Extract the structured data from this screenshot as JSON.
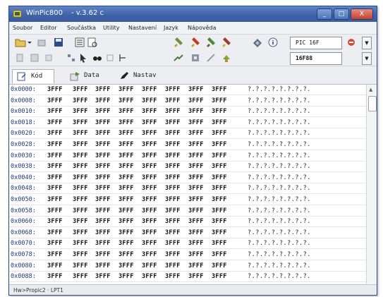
{
  "window": {
    "title": "WinPic800",
    "version": "- v.3.62 c",
    "controls": [
      "_",
      "□",
      "X"
    ]
  },
  "menu": [
    "Soubor",
    "Editor",
    "Součástka",
    "Utility",
    "Nastavení",
    "Jazyk",
    "Nápověda"
  ],
  "toolbar": {
    "row1_icons": [
      "open-folder-icon",
      "dropdown-arrow-icon",
      "recent-icon",
      "save-icon",
      "hex-view-icon",
      "preview-icon",
      "read-chip-icon",
      "write-chip-icon",
      "verify-chip-icon",
      "erase-chip-icon",
      "chip-test-icon",
      "info-icon"
    ],
    "row2_icons": [
      "copy-icon",
      "paste-icon",
      "clear-icon",
      "zoom-icon",
      "cursor-icon",
      "find-icon",
      "replace-icon",
      "fill-icon",
      "calibration-icon",
      "settings-icon",
      "hardware-icon",
      "config-icon"
    ],
    "device_family": "PIC 16F",
    "device_model": "16F88"
  },
  "tabs": [
    {
      "label": "Kód",
      "icon": "code-icon",
      "active": true
    },
    {
      "label": "Data",
      "icon": "data-icon",
      "active": false
    },
    {
      "label": "Nastav",
      "icon": "settings-pencil-icon",
      "active": false
    }
  ],
  "code_grid": {
    "rows": [
      {
        "addr": "0x0000:",
        "words": [
          "3FFF",
          "3FFF",
          "3FFF",
          "3FFF",
          "3FFF",
          "3FFF",
          "3FFF",
          "3FFF"
        ],
        "ascii": "?.?.?.?.?.?.?.?."
      },
      {
        "addr": "0x0008:",
        "words": [
          "3FFF",
          "3FFF",
          "3FFF",
          "3FFF",
          "3FFF",
          "3FFF",
          "3FFF",
          "3FFF"
        ],
        "ascii": "?.?.?.?.?.?.?.?."
      },
      {
        "addr": "0x0010:",
        "words": [
          "3FFF",
          "3FFF",
          "3FFF",
          "3FFF",
          "3FFF",
          "3FFF",
          "3FFF",
          "3FFF"
        ],
        "ascii": "?.?.?.?.?.?.?.?."
      },
      {
        "addr": "0x0018:",
        "words": [
          "3FFF",
          "3FFF",
          "3FFF",
          "3FFF",
          "3FFF",
          "3FFF",
          "3FFF",
          "3FFF"
        ],
        "ascii": "?.?.?.?.?.?.?.?."
      },
      {
        "addr": "0x0020:",
        "words": [
          "3FFF",
          "3FFF",
          "3FFF",
          "3FFF",
          "3FFF",
          "3FFF",
          "3FFF",
          "3FFF"
        ],
        "ascii": "?.?.?.?.?.?.?.?."
      },
      {
        "addr": "0x0028:",
        "words": [
          "3FFF",
          "3FFF",
          "3FFF",
          "3FFF",
          "3FFF",
          "3FFF",
          "3FFF",
          "3FFF"
        ],
        "ascii": "?.?.?.?.?.?.?.?."
      },
      {
        "addr": "0x0030:",
        "words": [
          "3FFF",
          "3FFF",
          "3FFF",
          "3FFF",
          "3FFF",
          "3FFF",
          "3FFF",
          "3FFF"
        ],
        "ascii": "?.?.?.?.?.?.?.?."
      },
      {
        "addr": "0x0038:",
        "words": [
          "3FFF",
          "3FFF",
          "3FFF",
          "3FFF",
          "3FFF",
          "3FFF",
          "3FFF",
          "3FFF"
        ],
        "ascii": "?.?.?.?.?.?.?.?."
      },
      {
        "addr": "0x0040:",
        "words": [
          "3FFF",
          "3FFF",
          "3FFF",
          "3FFF",
          "3FFF",
          "3FFF",
          "3FFF",
          "3FFF"
        ],
        "ascii": "?.?.?.?.?.?.?.?."
      },
      {
        "addr": "0x0048:",
        "words": [
          "3FFF",
          "3FFF",
          "3FFF",
          "3FFF",
          "3FFF",
          "3FFF",
          "3FFF",
          "3FFF"
        ],
        "ascii": "?.?.?.?.?.?.?.?."
      },
      {
        "addr": "0x0050:",
        "words": [
          "3FFF",
          "3FFF",
          "3FFF",
          "3FFF",
          "3FFF",
          "3FFF",
          "3FFF",
          "3FFF"
        ],
        "ascii": "?.?.?.?.?.?.?.?."
      },
      {
        "addr": "0x0058:",
        "words": [
          "3FFF",
          "3FFF",
          "3FFF",
          "3FFF",
          "3FFF",
          "3FFF",
          "3FFF",
          "3FFF"
        ],
        "ascii": "?.?.?.?.?.?.?.?."
      },
      {
        "addr": "0x0060:",
        "words": [
          "3FFF",
          "3FFF",
          "3FFF",
          "3FFF",
          "3FFF",
          "3FFF",
          "3FFF",
          "3FFF"
        ],
        "ascii": "?.?.?.?.?.?.?.?."
      },
      {
        "addr": "0x0068:",
        "words": [
          "3FFF",
          "3FFF",
          "3FFF",
          "3FFF",
          "3FFF",
          "3FFF",
          "3FFF",
          "3FFF"
        ],
        "ascii": "?.?.?.?.?.?.?.?."
      },
      {
        "addr": "0x0070:",
        "words": [
          "3FFF",
          "3FFF",
          "3FFF",
          "3FFF",
          "3FFF",
          "3FFF",
          "3FFF",
          "3FFF"
        ],
        "ascii": "?.?.?.?.?.?.?.?."
      },
      {
        "addr": "0x0078:",
        "words": [
          "3FFF",
          "3FFF",
          "3FFF",
          "3FFF",
          "3FFF",
          "3FFF",
          "3FFF",
          "3FFF"
        ],
        "ascii": "?.?.?.?.?.?.?.?."
      },
      {
        "addr": "0x0080:",
        "words": [
          "3FFF",
          "3FFF",
          "3FFF",
          "3FFF",
          "3FFF",
          "3FFF",
          "3FFF",
          "3FFF"
        ],
        "ascii": "?.?.?.?.?.?.?.?."
      },
      {
        "addr": "0x0088:",
        "words": [
          "3FFF",
          "3FFF",
          "3FFF",
          "3FFF",
          "3FFF",
          "3FFF",
          "3FFF",
          "3FFF"
        ],
        "ascii": "?.?.?.?.?.?.?.?."
      }
    ]
  },
  "status": "Hw>Propic2 · LPT1",
  "colors": {
    "titlebar": "#4a6fb5",
    "address": "#1f3b7a",
    "close_button": "#c1432f"
  }
}
